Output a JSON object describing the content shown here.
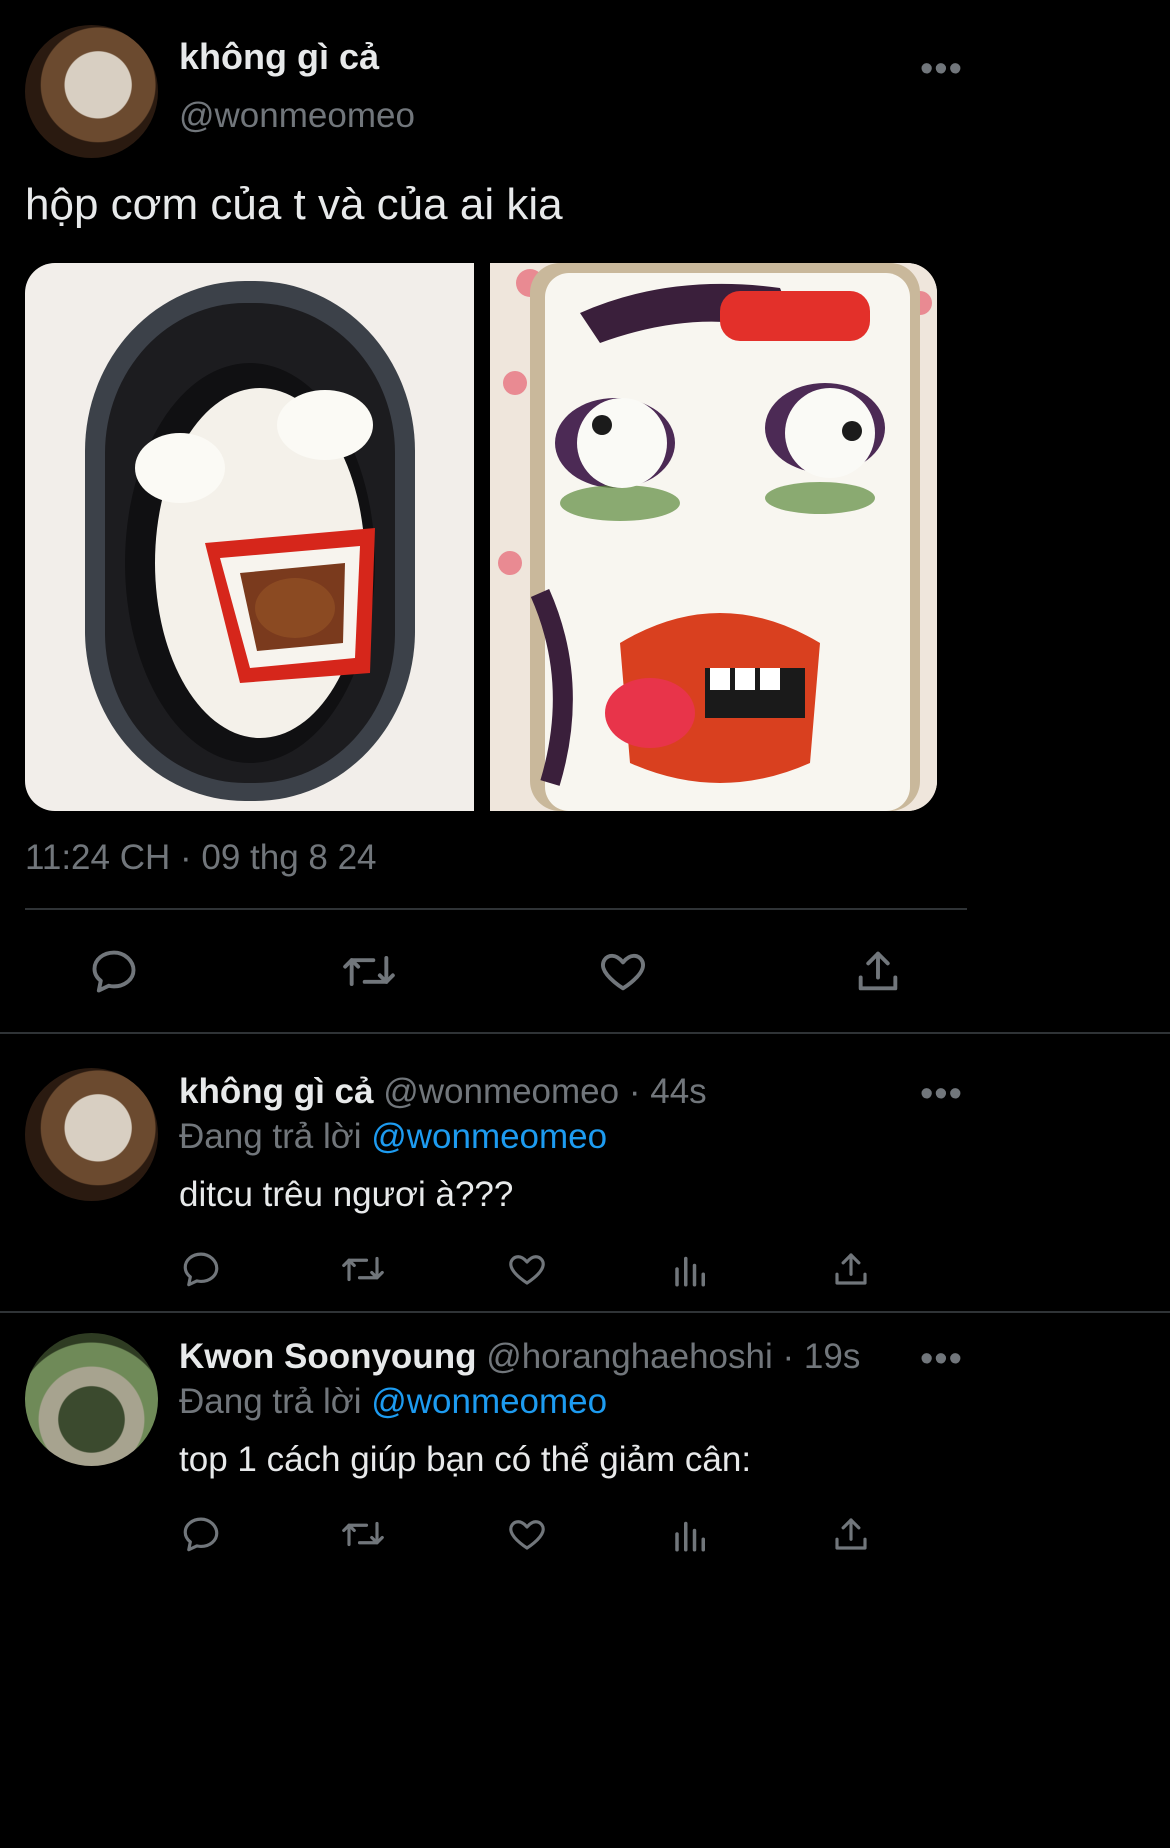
{
  "main_tweet": {
    "display_name": "không gì cả",
    "handle": "@wonmeomeo",
    "text": "hộp cơm của t và của ai kia",
    "timestamp": "11:24 CH · 09 thg 8 24",
    "images": [
      {
        "icon": "bento-rice-face-image"
      },
      {
        "icon": "bento-rice-face-image"
      }
    ]
  },
  "replies": [
    {
      "display_name": "không gì cả",
      "handle": "@wonmeomeo",
      "time": "· 44s",
      "replying_prefix": "Đang trả lời",
      "replying_to": "@wonmeomeo",
      "text": "ditcu trêu ngươi à???"
    },
    {
      "display_name": "Kwon Soonyoung",
      "handle": "@horanghaehoshi",
      "time": "· 19s",
      "replying_prefix": "Đang trả lời",
      "replying_to": "@wonmeomeo",
      "text": "top 1 cách giúp bạn có thể giảm cân:"
    }
  ],
  "colors": {
    "background": "#000000",
    "text": "#e7e9ea",
    "secondary": "#71767b",
    "accent": "#1d9bf0",
    "divider": "#2f3336"
  }
}
